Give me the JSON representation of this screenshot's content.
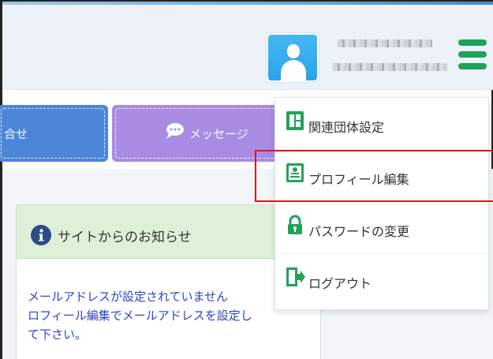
{
  "nav": {
    "contact_label": "合せ",
    "message_label": "メッセージ"
  },
  "notice": {
    "title": "サイトからのお知らせ",
    "body_lines": [
      "メールアドレスが設定されていません",
      "ロフィール編集でメールアドレスを設定し",
      "て下さい。"
    ]
  },
  "dropdown": {
    "items": [
      {
        "label": "関連団体設定",
        "icon": "organization-icon"
      },
      {
        "label": "プロフィール編集",
        "icon": "profile-card-icon"
      },
      {
        "label": "パスワードの変更",
        "icon": "lock-icon"
      },
      {
        "label": "ログアウト",
        "icon": "logout-door-icon"
      }
    ]
  },
  "colors": {
    "accent_green": "#1fa159",
    "contact_button": "#4d86d9",
    "message_button": "#a88ce4",
    "notice_header": "#dff0d8",
    "notice_text": "#2b43c8",
    "highlight": "#e3141a"
  }
}
